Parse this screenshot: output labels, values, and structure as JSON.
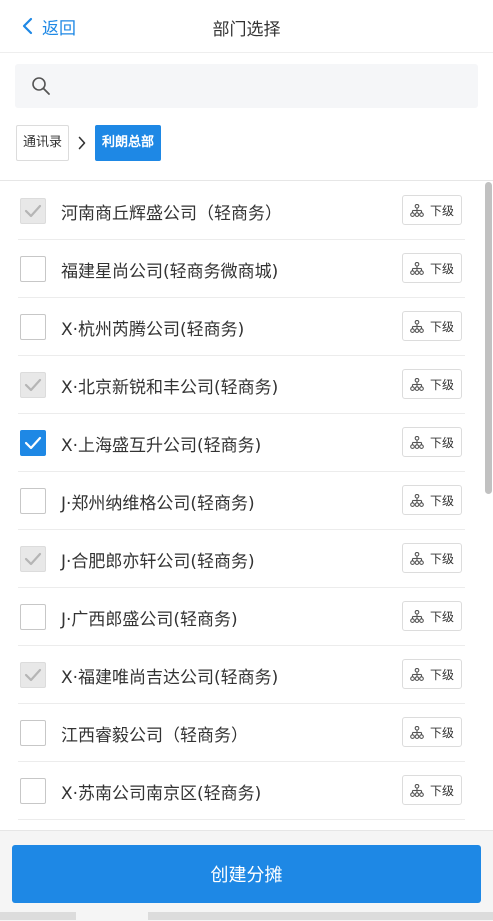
{
  "header": {
    "back_label": "返回",
    "title": "部门选择"
  },
  "search": {
    "placeholder": ""
  },
  "breadcrumb": {
    "items": [
      "通讯录",
      "利朗总部"
    ]
  },
  "departments": [
    {
      "name": "河南商丘辉盛公司（轻商务）",
      "state": "disabled",
      "sub_label": "下级"
    },
    {
      "name": "福建星尚公司(轻商务微商城)",
      "state": "unchecked",
      "sub_label": "下级"
    },
    {
      "name": "X·杭州芮腾公司(轻商务)",
      "state": "unchecked",
      "sub_label": "下级"
    },
    {
      "name": "X·北京新锐和丰公司(轻商务)",
      "state": "disabled",
      "sub_label": "下级"
    },
    {
      "name": "X·上海盛互升公司(轻商务)",
      "state": "checked",
      "sub_label": "下级"
    },
    {
      "name": "J·郑州纳维格公司(轻商务)",
      "state": "unchecked",
      "sub_label": "下级"
    },
    {
      "name": "J·合肥郎亦轩公司(轻商务)",
      "state": "disabled",
      "sub_label": "下级"
    },
    {
      "name": "J·广西郎盛公司(轻商务)",
      "state": "unchecked",
      "sub_label": "下级"
    },
    {
      "name": "X·福建唯尚吉达公司(轻商务)",
      "state": "disabled",
      "sub_label": "下级"
    },
    {
      "name": "江西睿毅公司（轻商务）",
      "state": "unchecked",
      "sub_label": "下级"
    },
    {
      "name": "X·苏南公司南京区(轻商务)",
      "state": "unchecked",
      "sub_label": "下级"
    }
  ],
  "footer": {
    "create_label": "创建分摊"
  },
  "icons": {
    "back": "chevron-left-icon",
    "search": "search-icon",
    "breadcrumb_sep": "chevron-right-icon",
    "sub": "org-tree-icon",
    "check": "check-icon"
  },
  "colors": {
    "accent": "#1e88e5",
    "disabled": "#e8e8e8"
  }
}
